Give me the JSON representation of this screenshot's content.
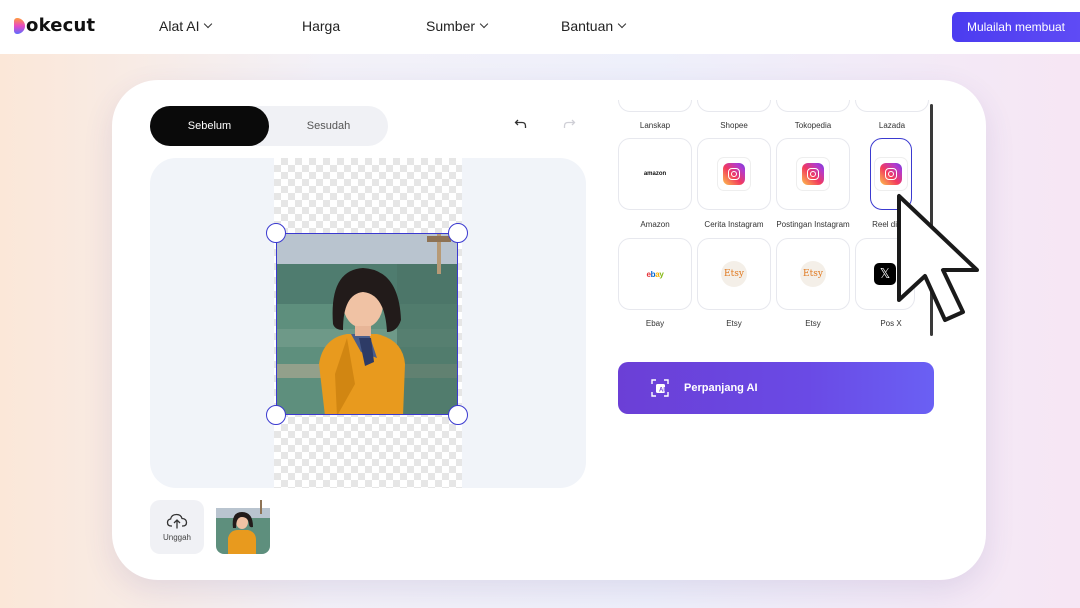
{
  "brand": {
    "name": "okecut"
  },
  "nav": {
    "items": [
      {
        "label": "Alat AI",
        "dropdown": true
      },
      {
        "label": "Harga",
        "dropdown": false
      },
      {
        "label": "Sumber",
        "dropdown": true
      },
      {
        "label": "Bantuan",
        "dropdown": true
      }
    ],
    "cta": "Mulailah membuat"
  },
  "editor": {
    "toggle": {
      "before": "Sebelum",
      "after": "Sesudah",
      "active": "before"
    },
    "upload_label": "Unggah"
  },
  "platforms": {
    "row_partial": [
      "Lanskap",
      "Shopee",
      "Tokopedia",
      "Lazada"
    ],
    "row1": [
      {
        "label": "Amazon",
        "icon": "amazon-logo"
      },
      {
        "label": "Cerita Instagram",
        "icon": "instagram-icon"
      },
      {
        "label": "Postingan Instagram",
        "icon": "instagram-icon"
      },
      {
        "label": "Reel di Ins",
        "icon": "instagram-icon",
        "selected": true
      }
    ],
    "row2": [
      {
        "label": "Ebay",
        "icon": "ebay-logo"
      },
      {
        "label": "Etsy",
        "icon": "etsy-logo"
      },
      {
        "label": "Etsy",
        "icon": "etsy-logo"
      },
      {
        "label": "Pos X",
        "icon": "x-logo"
      }
    ],
    "amazon_text": "amazon",
    "ebay_text": "ebay",
    "etsy_text": "Etsy",
    "x_text": "𝕏"
  },
  "extend_button": "Perpanjang AI",
  "colors": {
    "accent": "#4b3cf0",
    "extend_button": "#6b3fd6",
    "selection": "#3b3ad0"
  }
}
